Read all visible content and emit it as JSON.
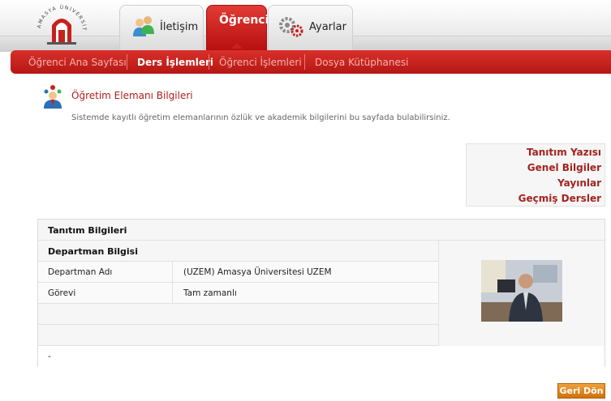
{
  "header": {
    "logo_text": "AMASYA ÜNİVERSİTESİ",
    "tabs": [
      {
        "label": "İletişim",
        "icon": "contacts-icon"
      },
      {
        "label": "Öğrenci",
        "icon": "",
        "active": true
      },
      {
        "label": "Ayarlar",
        "icon": "settings-gears-icon"
      }
    ]
  },
  "nav": {
    "items": [
      {
        "label": "Öğrenci Ana Sayfası",
        "active": false
      },
      {
        "label": "Ders İşlemleri",
        "active": true
      },
      {
        "label": "Öğrenci İşlemleri",
        "active": false
      },
      {
        "label": "Dosya Kütüphanesi",
        "active": false
      }
    ]
  },
  "page": {
    "title": "Öğretim Elemanı Bilgileri",
    "description": "Sistemde kayıtlı öğretim elemanlarının özlük ve akademik bilgilerini bu sayfada bulabilirsiniz.",
    "icon": "instructor-icon"
  },
  "side_links": [
    "Tanıtım Yazısı",
    "Genel Bilgiler",
    "Yayınlar",
    "Geçmiş Dersler"
  ],
  "panel": {
    "section_title": "Tanıtım Bilgileri",
    "subsection_title": "Departman Bilgisi",
    "rows": [
      {
        "label": "Departman Adı",
        "value": "(UZEM) Amasya Üniversitesi UZEM"
      },
      {
        "label": "Görevi",
        "value": "Tam zamanlı"
      }
    ],
    "intro_text": "-"
  },
  "buttons": {
    "back": "Geri Dön"
  },
  "colors": {
    "brand_red": "#c8201d",
    "link_red": "#a3231f",
    "button_orange": "#e08a1e"
  }
}
